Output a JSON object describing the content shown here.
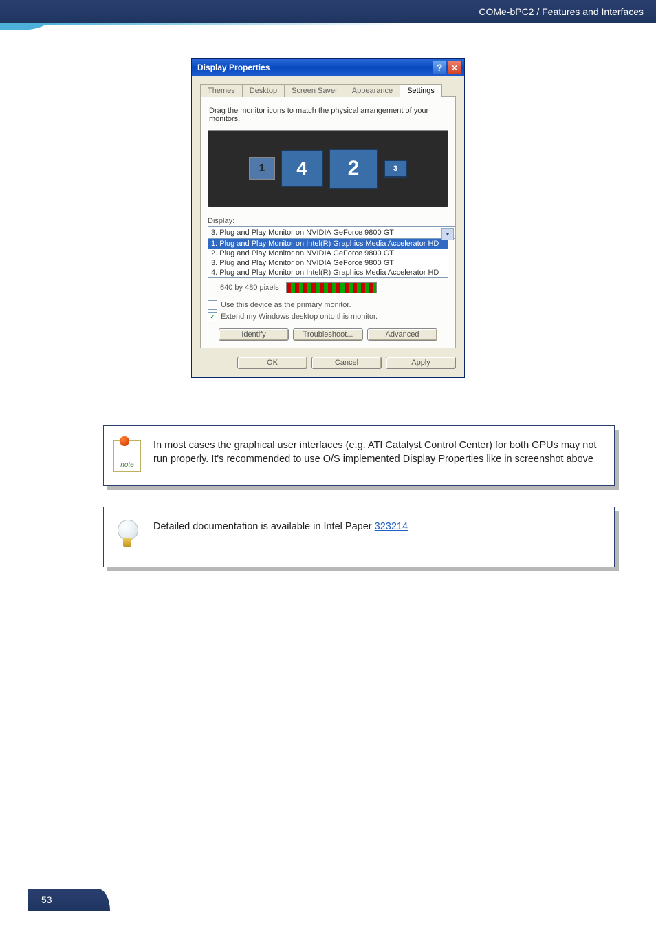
{
  "header": {
    "breadcrumb": "COMe-bPC2 / Features and Interfaces"
  },
  "dialog": {
    "title": "Display Properties",
    "tabs": [
      "Themes",
      "Desktop",
      "Screen Saver",
      "Appearance",
      "Settings"
    ],
    "active_tab": 4,
    "drag_text": "Drag the monitor icons to match the physical arrangement of your monitors.",
    "monitors": [
      "1",
      "4",
      "2",
      "3"
    ],
    "display_label": "Display:",
    "combo_selected": "3. Plug and Play Monitor on NVIDIA GeForce 9800 GT",
    "dropdown_items": [
      {
        "text": "1. Plug and Play Monitor on Intel(R) Graphics Media Accelerator HD",
        "selected": true
      },
      {
        "text": "2. Plug and Play Monitor on NVIDIA GeForce 9800 GT",
        "selected": false
      },
      {
        "text": "3. Plug and Play Monitor on NVIDIA GeForce 9800 GT",
        "selected": false
      },
      {
        "text": "4. Plug and Play Monitor on Intel(R) Graphics Media Accelerator HD",
        "selected": false
      }
    ],
    "resolution_text": "640 by 480 pixels",
    "chk_primary": "Use this device as the primary monitor.",
    "chk_extend": "Extend my Windows desktop onto this monitor.",
    "btn_identify": "Identify",
    "btn_troubleshoot": "Troubleshoot...",
    "btn_advanced": "Advanced",
    "btn_ok": "OK",
    "btn_cancel": "Cancel",
    "btn_apply": "Apply"
  },
  "note1": {
    "text": "In most cases the graphical user interfaces (e.g. ATI Catalyst Control Center) for both GPUs may not run properly. It's recommended to use O/S implemented Display Properties like in screenshot above"
  },
  "note2": {
    "prefix": "Detailed documentation is available in Intel Paper ",
    "link": "323214"
  },
  "footer": {
    "page": "53"
  }
}
